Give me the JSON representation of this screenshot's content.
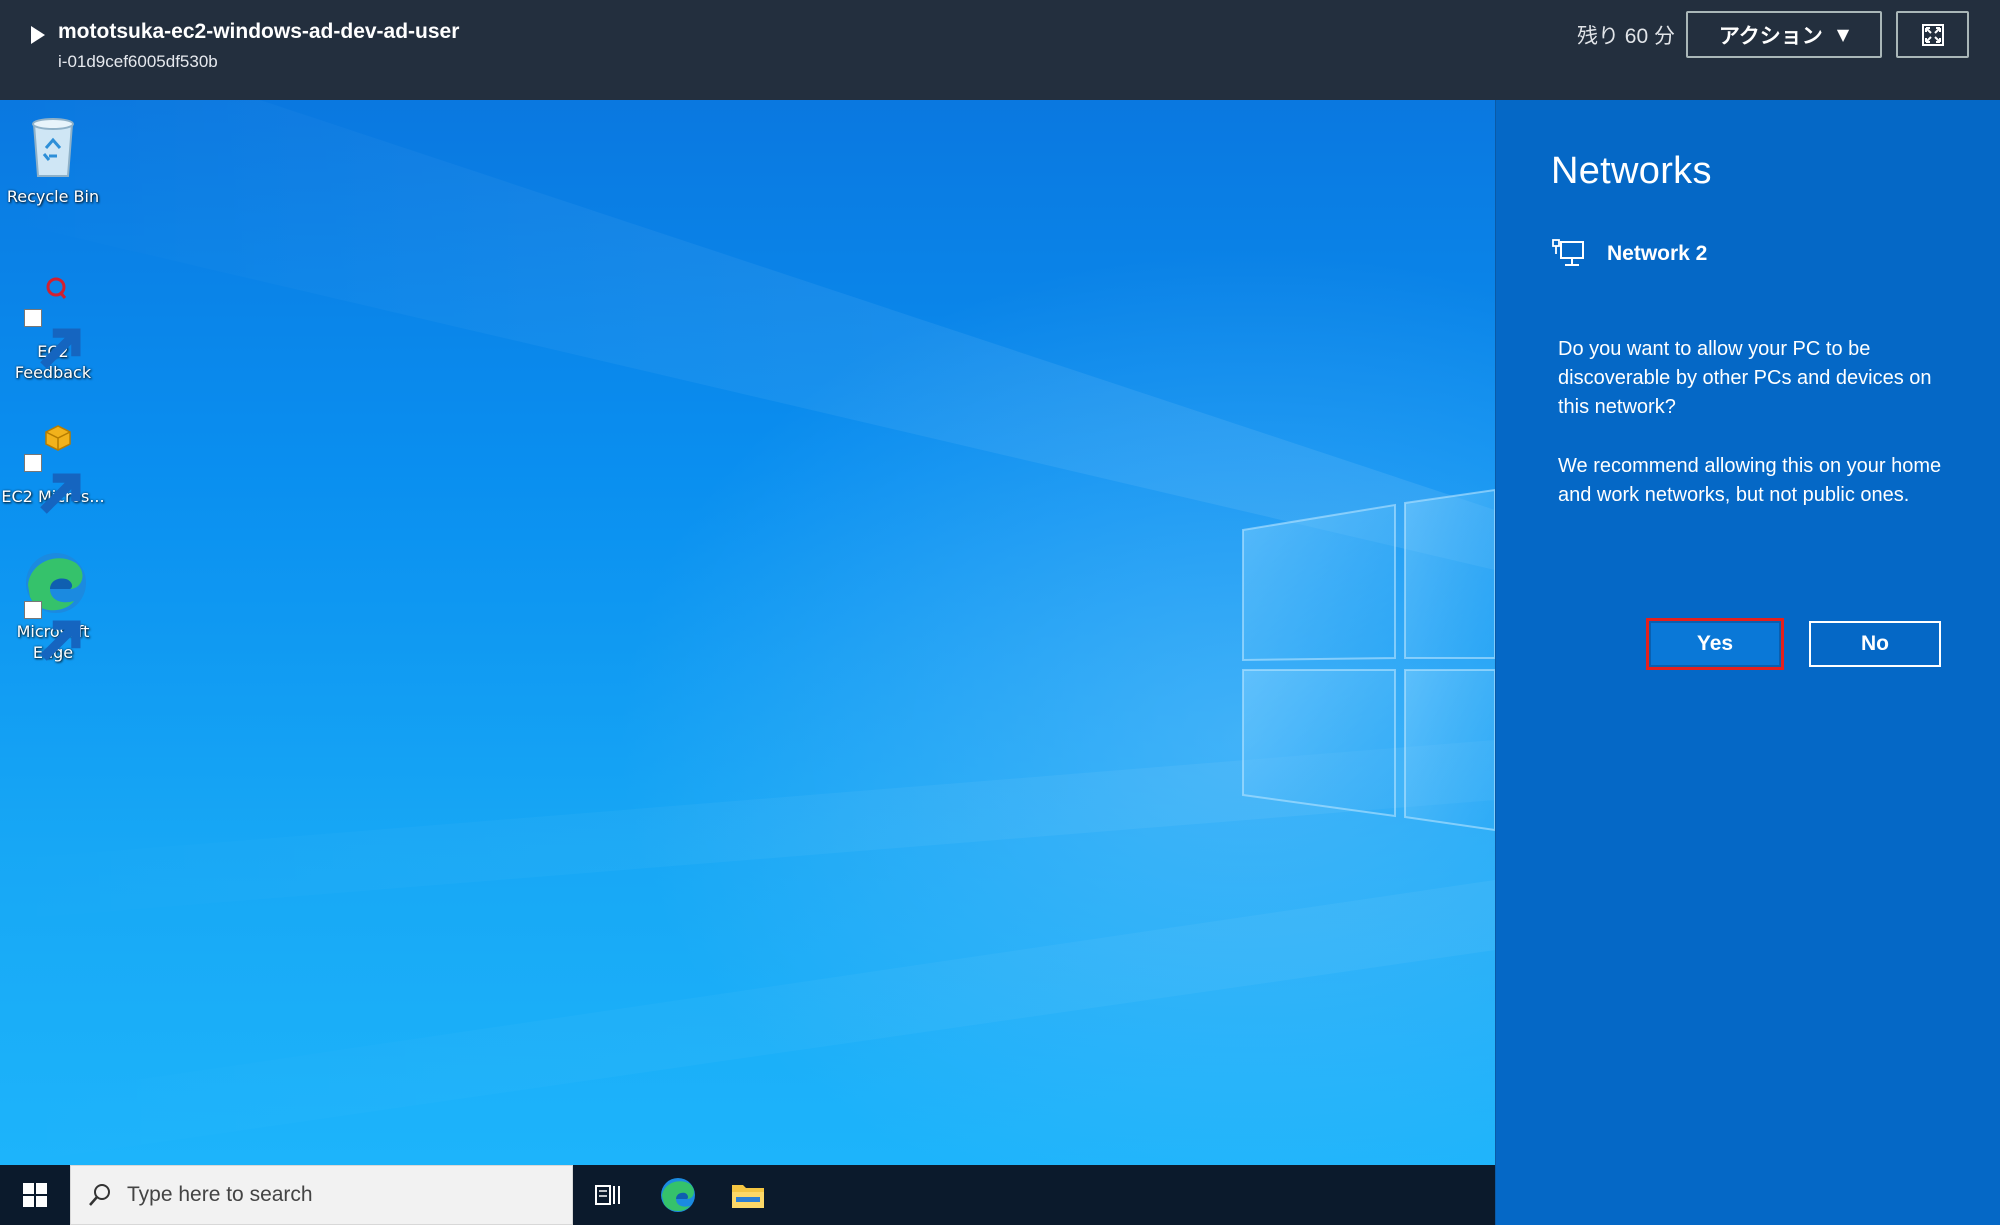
{
  "console": {
    "instance_name": "mototsuka-ec2-windows-ad-dev-ad-user",
    "instance_id": "i-01d9cef6005df530b",
    "time_remaining": "残り 60 分",
    "actions_label": "アクション",
    "actions_caret": "▼",
    "toggle_icon": "play-triangle-icon",
    "fullscreen_icon": "fullscreen-icon",
    "bar_color": "#232f3e"
  },
  "desktop": {
    "icons": [
      {
        "label": "Recycle Bin",
        "icon": "recycle-bin-icon"
      },
      {
        "label": "EC2 Feedback",
        "icon": "ec2-feedback-icon"
      },
      {
        "label": "EC2 Micros...",
        "icon": "ec2-package-icon"
      },
      {
        "label": "Microsoft Edge",
        "icon": "edge-icon"
      }
    ]
  },
  "network_panel": {
    "title": "Networks",
    "network_name": "Network 2",
    "network_icon": "wired-network-icon",
    "question": "Do you want to allow your PC to be discoverable by other PCs and devices on this network?",
    "recommendation": "We recommend allowing this on your home and work networks, but not public ones.",
    "yes_label": "Yes",
    "no_label": "No",
    "panel_color": "#0568c6",
    "highlight_color": "#e5201d"
  },
  "taskbar": {
    "search_placeholder": "Type here to search",
    "icons": [
      "windows-start-icon",
      "search-icon",
      "task-view-icon",
      "edge-icon",
      "file-explorer-icon"
    ]
  }
}
